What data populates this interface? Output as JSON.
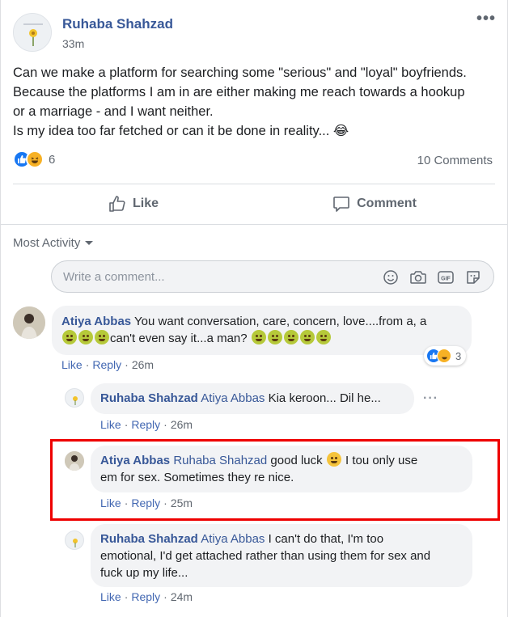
{
  "post": {
    "author": "Ruhaba Shahzad",
    "time": "33m",
    "lines": [
      "Can we make a platform for searching some \"serious\" and \"loyal\" boyfriends.",
      "Because the platforms I am in are either making me reach towards a hookup",
      "or a marriage - and I want neither.",
      "Is my idea too far fetched or can it be done in reality... 😂"
    ],
    "reaction_count": "6",
    "comments_count": "10 Comments",
    "like_label": "Like",
    "comment_label": "Comment"
  },
  "sort": {
    "label": "Most Activity"
  },
  "composer": {
    "placeholder": "Write a comment..."
  },
  "comments": [
    {
      "author": "Atiya Abbas",
      "text_a": "You want conversation, care, concern, love....from a, a",
      "text_b": "can't even say it...a man?",
      "like": "Like",
      "reply": "Reply",
      "time": "26m",
      "reactions": "3"
    },
    {
      "author": "Ruhaba Shahzad",
      "mention": "Atiya Abbas",
      "text": "Kia keroon... Dil he...",
      "like": "Like",
      "reply": "Reply",
      "time": "26m"
    },
    {
      "author": "Atiya Abbas",
      "mention": "Ruhaba Shahzad",
      "text_a": "good luck",
      "text_b": "I tou only use",
      "text_c": "em for sex. Sometimes they re nice.",
      "like": "Like",
      "reply": "Reply",
      "time": "25m"
    },
    {
      "author": "Ruhaba Shahzad",
      "mention": "Atiya Abbas",
      "text_a": "I can't do that, I'm too",
      "text_b": "emotional, I'd get attached rather than using them for sex and",
      "text_c": "fuck up my life...",
      "like": "Like",
      "reply": "Reply",
      "time": "24m"
    }
  ],
  "colors": {
    "name_blue": "#385898",
    "link_blue": "#4267b2",
    "highlight_red": "#ee0000",
    "like_blue": "#1877f2"
  }
}
